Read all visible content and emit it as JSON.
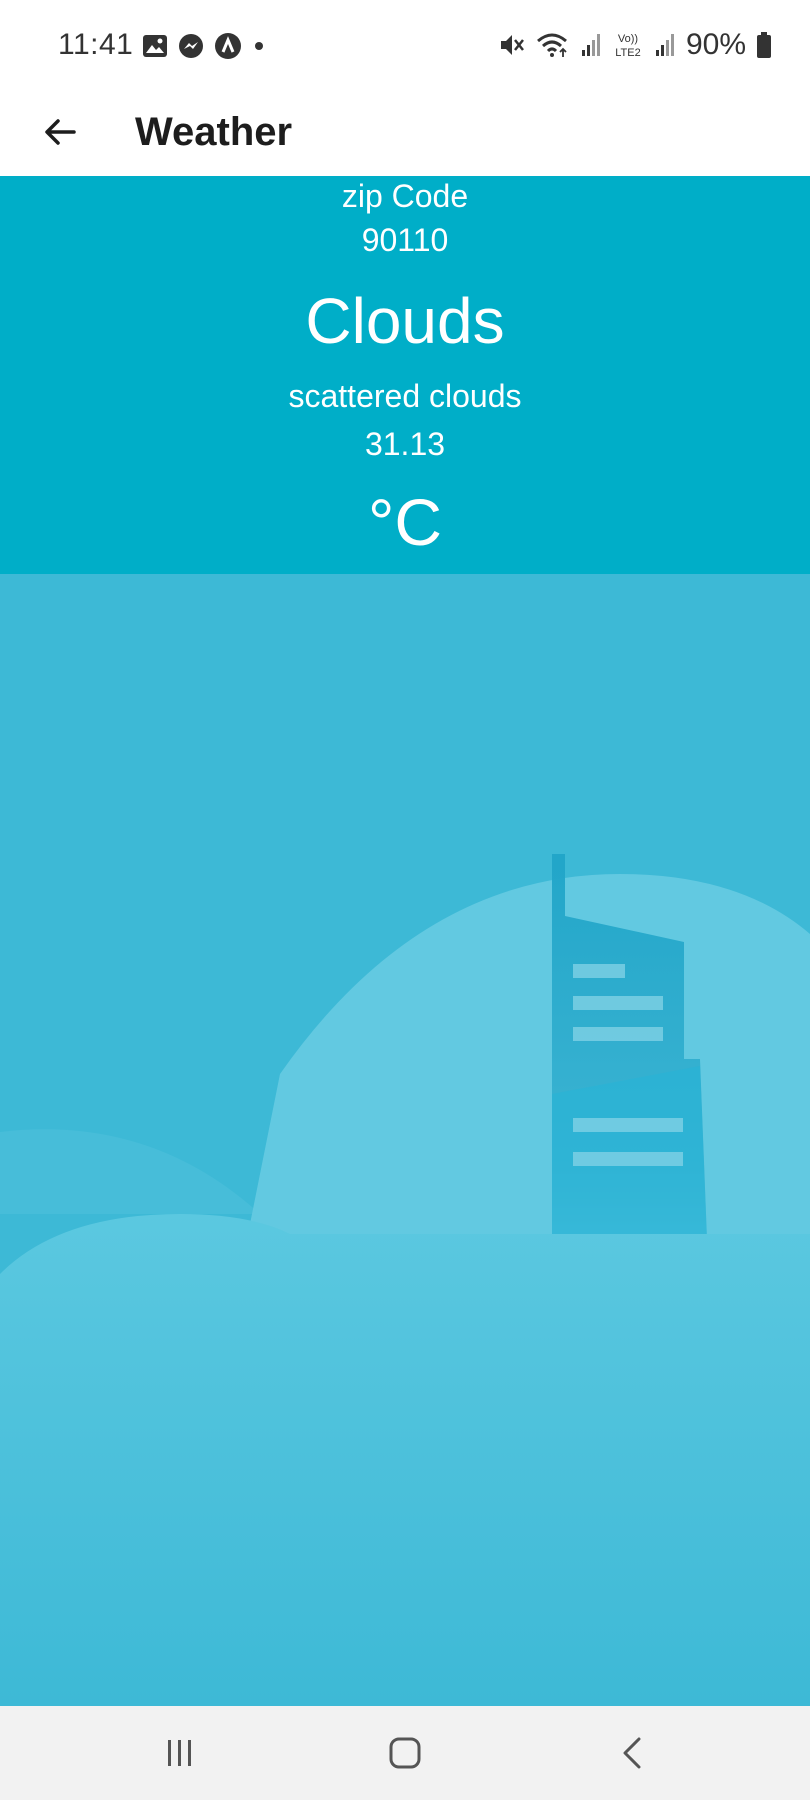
{
  "status_bar": {
    "time": "11:41",
    "battery": "90%",
    "left_icons": [
      "gallery-icon",
      "messenger-icon",
      "app-icon",
      "dot-icon"
    ],
    "right_icons": [
      "mute-icon",
      "wifi-icon",
      "signal-icon",
      "volte-lte2-icon",
      "signal-icon-2",
      "battery-icon"
    ]
  },
  "app_bar": {
    "title": "Weather",
    "back_icon": "arrow-left-icon"
  },
  "weather": {
    "zip_label": "zip Code",
    "zip_value": "90110",
    "main": "Clouds",
    "description": "scattered clouds",
    "temperature": "31.13",
    "unit": "°C"
  },
  "colors": {
    "header_bg": "#00aec8",
    "body_bg": "#3db9d6",
    "app_bar_bg": "#ffffff"
  },
  "nav_bar": {
    "icons": [
      "recent-apps-icon",
      "home-icon",
      "back-icon"
    ]
  }
}
